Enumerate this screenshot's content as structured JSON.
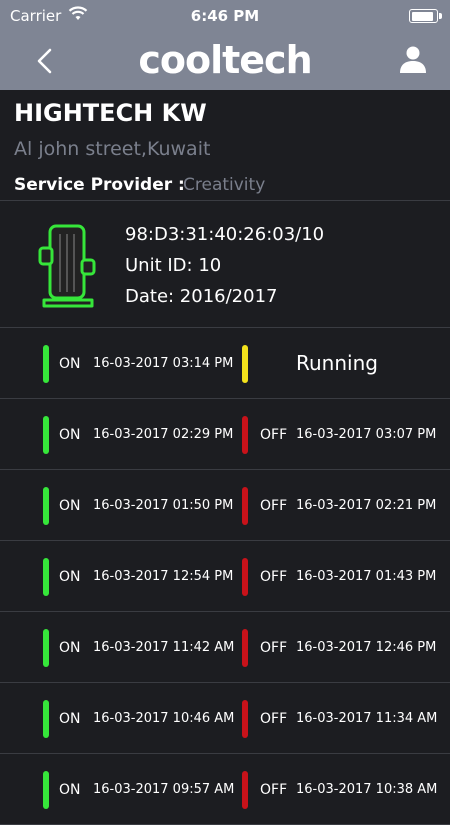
{
  "status_bar": {
    "carrier": "Carrier",
    "time": "6:46 PM",
    "battery_level": 1.0
  },
  "nav": {
    "logo_text": "cooltech",
    "back_icon": "chevron-left-icon",
    "user_icon": "user-icon"
  },
  "header": {
    "company": "HIGHTECH KW",
    "address": "Al john street,Kuwait",
    "service_provider_label": "Service Provider :",
    "service_provider_value": "Creativity"
  },
  "unit": {
    "mac": "98:D3:31:40:26:03/10",
    "unit_id": "Unit ID: 10",
    "date": "Date: 2016/2017"
  },
  "colors": {
    "on": "#36e63a",
    "off": "#c8121a",
    "running": "#f3e21c",
    "nav": "#7f8594"
  },
  "logs": [
    {
      "on_label": "ON",
      "on_time": "16-03-2017 03:14 PM",
      "status": "Running"
    },
    {
      "on_label": "ON",
      "on_time": "16-03-2017 02:29 PM",
      "off_label": "OFF",
      "off_time": "16-03-2017 03:07 PM"
    },
    {
      "on_label": "ON",
      "on_time": "16-03-2017 01:50 PM",
      "off_label": "OFF",
      "off_time": "16-03-2017 02:21 PM"
    },
    {
      "on_label": "ON",
      "on_time": "16-03-2017 12:54 PM",
      "off_label": "OFF",
      "off_time": "16-03-2017 01:43 PM"
    },
    {
      "on_label": "ON",
      "on_time": "16-03-2017 11:42 AM",
      "off_label": "OFF",
      "off_time": "16-03-2017 12:46 PM"
    },
    {
      "on_label": "ON",
      "on_time": "16-03-2017 10:46 AM",
      "off_label": "OFF",
      "off_time": "16-03-2017 11:34 AM"
    },
    {
      "on_label": "ON",
      "on_time": "16-03-2017 09:57 AM",
      "off_label": "OFF",
      "off_time": "16-03-2017 10:38 AM"
    }
  ]
}
